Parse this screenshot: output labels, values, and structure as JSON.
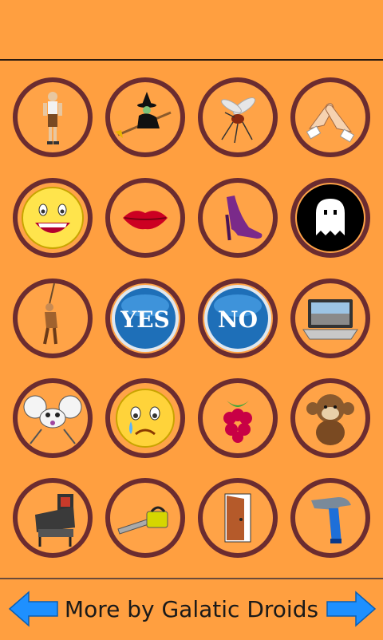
{
  "grid": {
    "items": [
      {
        "icon": "lederhosen-man-icon"
      },
      {
        "icon": "witch-on-broom-icon"
      },
      {
        "icon": "mosquito-icon"
      },
      {
        "icon": "clapping-hands-icon"
      },
      {
        "icon": "laughing-smiley-icon"
      },
      {
        "icon": "lips-icon"
      },
      {
        "icon": "high-heel-shoe-icon"
      },
      {
        "icon": "ghost-icon"
      },
      {
        "icon": "hanging-man-icon"
      },
      {
        "icon": "yes-button-icon",
        "label": "YES"
      },
      {
        "icon": "no-button-icon",
        "label": "NO"
      },
      {
        "icon": "laptop-icon"
      },
      {
        "icon": "mouse-icon"
      },
      {
        "icon": "crying-smiley-icon"
      },
      {
        "icon": "raspberry-icon"
      },
      {
        "icon": "monkey-plush-icon"
      },
      {
        "icon": "pinball-machine-icon"
      },
      {
        "icon": "chainsaw-icon"
      },
      {
        "icon": "door-icon"
      },
      {
        "icon": "hammer-icon"
      }
    ]
  },
  "footer": {
    "label": "More by Galatic Droids",
    "left_arrow_icon": "arrow-left-icon",
    "right_arrow_icon": "arrow-right-icon"
  },
  "colors": {
    "background": "#ff9f40",
    "ring": "#6b2c30",
    "arrow": "#1e90ff"
  }
}
